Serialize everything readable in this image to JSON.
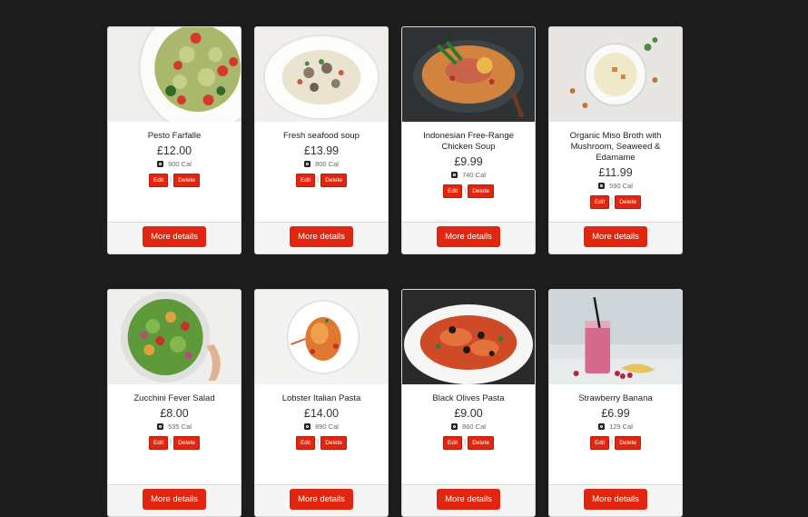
{
  "menu": {
    "edit_label": "Edit",
    "delete_label": "Delete",
    "more_label": "More details",
    "items": [
      {
        "name": "Pesto Farfalle",
        "price": "£12.00",
        "calories": "900 Cal",
        "photo": "pesto-farfalle"
      },
      {
        "name": "Fresh seafood soup",
        "price": "£13.99",
        "calories": "800 Cal",
        "photo": "seafood-soup"
      },
      {
        "name": "Indonesian Free-Range Chicken Soup",
        "price": "£9.99",
        "calories": "740 Cal",
        "photo": "chicken-soup"
      },
      {
        "name": "Organic Miso Broth with Mushroom, Seaweed & Edamame",
        "price": "£11.99",
        "calories": "590 Cal",
        "photo": "miso-broth"
      },
      {
        "name": "Zucchini Fever Salad",
        "price": "£8.00",
        "calories": "535 Cal",
        "photo": "zucchini-salad"
      },
      {
        "name": "Lobster Italian Pasta",
        "price": "£14.00",
        "calories": "890 Cal",
        "photo": "lobster-pasta"
      },
      {
        "name": "Black Olives Pasta",
        "price": "£9.00",
        "calories": "860 Cal",
        "photo": "olives-pasta"
      },
      {
        "name": "Strawberry Banana",
        "price": "£6.99",
        "calories": "129 Cal",
        "photo": "smoothie"
      }
    ]
  },
  "colors": {
    "page_bg": "#1c1c1c",
    "accent": "#e0260e",
    "card_bg": "#ffffff",
    "footer_bg": "#f5f5f5"
  },
  "icons": {
    "calorie": "calorie-icon"
  }
}
